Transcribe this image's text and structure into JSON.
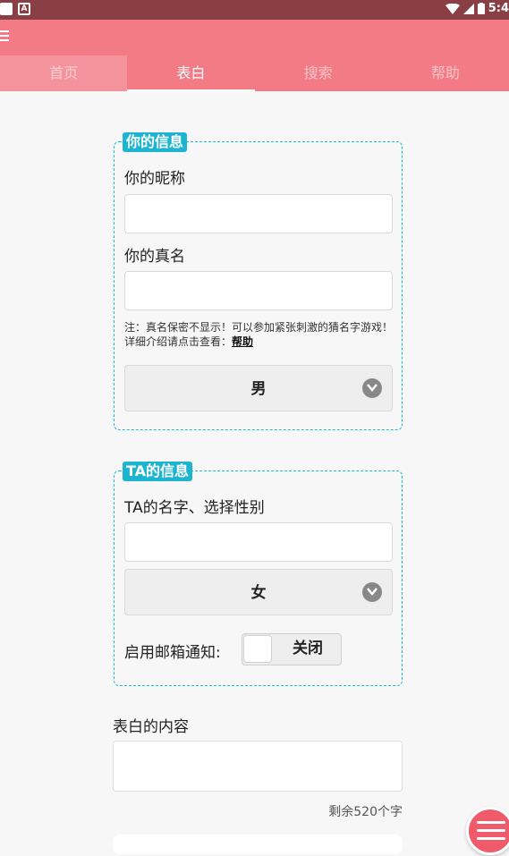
{
  "status_bar": {
    "time": "5:4"
  },
  "tabs": [
    {
      "label": "首页"
    },
    {
      "label": "表白"
    },
    {
      "label": "搜索"
    },
    {
      "label": "帮助"
    }
  ],
  "your_info": {
    "legend": "你的信息",
    "nickname_label": "你的昵称",
    "nickname_value": "",
    "realname_label": "你的真名",
    "realname_value": "",
    "note": "注：真名保密不显示！可以参加紧张刺激的猜名字游戏！详细介绍请点击查看：",
    "note_link": "帮助",
    "gender": "男"
  },
  "their_info": {
    "legend": "TA的信息",
    "name_label": "TA的名字、选择性别",
    "name_value": "",
    "gender": "女",
    "email_notify_label": "启用邮箱通知:",
    "email_notify_state": "关闭"
  },
  "content": {
    "label": "表白的内容",
    "value": "",
    "counter": "剩余520个字"
  },
  "colors": {
    "status_bar": "#8a3f44",
    "app_bar": "#f27b86",
    "accent": "#1db8d6",
    "fab": "#ef5b6b"
  }
}
